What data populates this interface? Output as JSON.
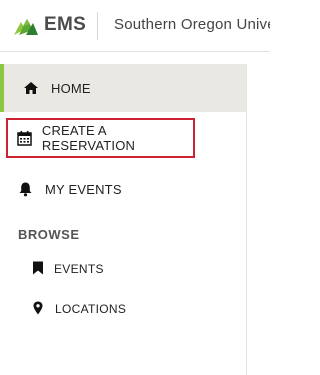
{
  "header": {
    "logo_text": "EMS",
    "logo_icon": "ems-logo-icon",
    "org_name": "Southern Oregon University"
  },
  "sidebar": {
    "items": [
      {
        "label": "HOME",
        "icon": "home-icon"
      },
      {
        "label": "CREATE A RESERVATION",
        "icon": "calendar-icon",
        "highlighted": true
      },
      {
        "label": "MY EVENTS",
        "icon": "bell-icon"
      }
    ],
    "browse": {
      "heading": "BROWSE",
      "items": [
        {
          "label": "EVENTS",
          "icon": "bookmark-icon"
        },
        {
          "label": "LOCATIONS",
          "icon": "map-pin-icon"
        }
      ]
    }
  },
  "colors": {
    "accent_green": "#8dc63f",
    "highlight_border": "#cc2233",
    "active_bg": "#e9e8e3"
  }
}
